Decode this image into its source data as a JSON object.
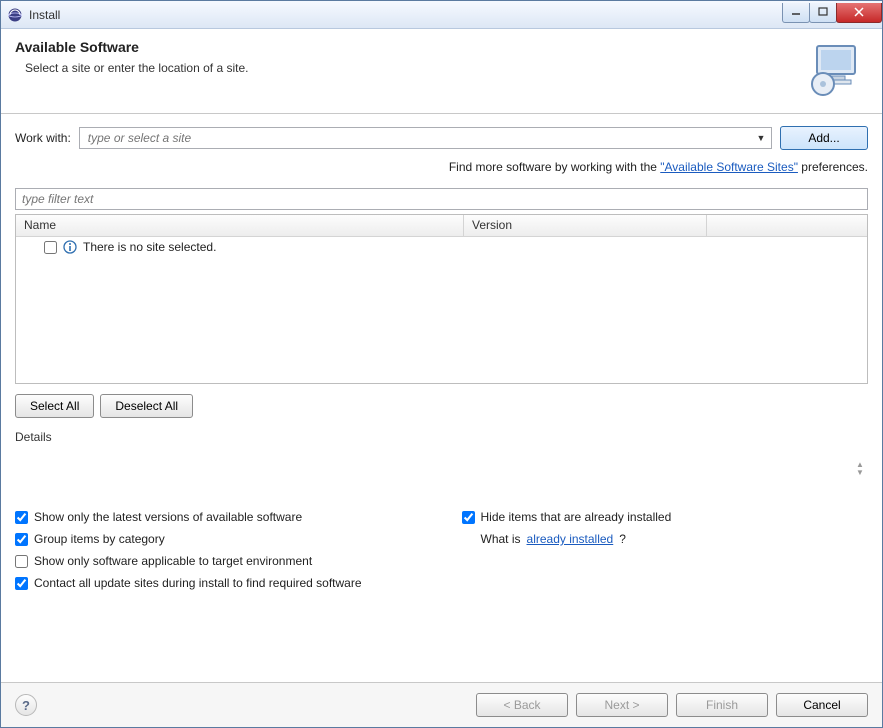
{
  "window": {
    "title": "Install"
  },
  "banner": {
    "heading": "Available Software",
    "sub": "Select a site or enter the location of a site."
  },
  "workwith": {
    "label": "Work with:",
    "placeholder": "type or select a site",
    "add_label": "Add..."
  },
  "hint": {
    "prefix": "Find more software by working with the ",
    "link": "\"Available Software Sites\"",
    "suffix": " preferences."
  },
  "filter": {
    "placeholder": "type filter text"
  },
  "table": {
    "col_name": "Name",
    "col_version": "Version",
    "empty_msg": "There is no site selected."
  },
  "buttons": {
    "select_all": "Select All",
    "deselect_all": "Deselect All"
  },
  "details": {
    "label": "Details"
  },
  "options": {
    "latest": "Show only the latest versions of available software",
    "group": "Group items by category",
    "target": "Show only software applicable to target environment",
    "contact": "Contact all update sites during install to find required software",
    "hide": "Hide items that are already installed",
    "whatis_prefix": "What is ",
    "whatis_link": "already installed",
    "whatis_suffix": "?"
  },
  "footer": {
    "back": "< Back",
    "next": "Next >",
    "finish": "Finish",
    "cancel": "Cancel"
  }
}
